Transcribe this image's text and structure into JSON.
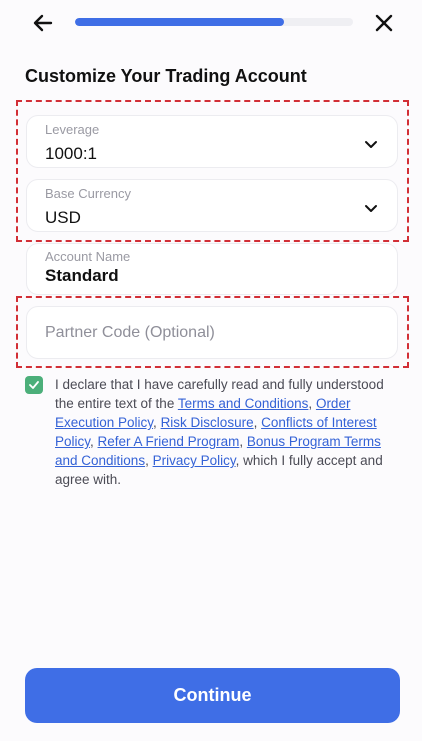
{
  "header": {
    "back_icon": "arrow-left-icon",
    "close_icon": "close-icon",
    "progress_fraction": 0.75,
    "progress_color": "#3f6ee6"
  },
  "page": {
    "title": "Customize Your Trading Account"
  },
  "form": {
    "leverage": {
      "label": "Leverage",
      "value": "1000:1"
    },
    "base_currency": {
      "label": "Base Currency",
      "value": "USD"
    },
    "account_name": {
      "label": "Account Name",
      "value": "Standard"
    },
    "partner_code": {
      "placeholder": "Partner Code (Optional)"
    }
  },
  "agreement": {
    "checked": true,
    "checkbox_color": "#4caf7a",
    "text_1": "I declare that I have carefully read and fully understood the entire text of the ",
    "link_terms": "Terms and Conditions",
    "sep_1": ", ",
    "link_order_execution": "Order Execution Policy",
    "sep_2": ", ",
    "link_risk_disclosure": "Risk Disclosure",
    "sep_3": ", ",
    "link_conflicts": "Conflicts of Interest Policy",
    "sep_4": ", ",
    "link_refer_friend": "Refer A Friend Program",
    "sep_5": ", ",
    "link_bonus_terms": "Bonus Program Terms and Conditions",
    "sep_6": ", ",
    "link_privacy": "Privacy Policy",
    "text_end": ", which I fully accept and agree with."
  },
  "actions": {
    "continue_label": "Continue",
    "continue_color": "#3f6ee6"
  },
  "annotations": {
    "highlight_color": "#d22f36"
  }
}
